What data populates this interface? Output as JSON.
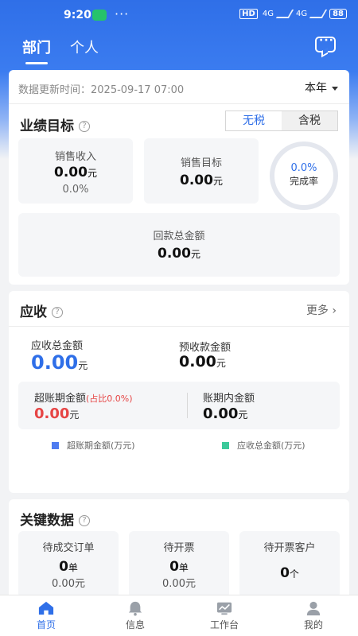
{
  "status_bar": {
    "time": "9:20",
    "dots": "···",
    "hd": "HD",
    "net1": "4G",
    "net2": "4G",
    "battery": "88"
  },
  "tabs": {
    "dept": "部门",
    "personal": "个人"
  },
  "summary": {
    "update_label": "数据更新时间：",
    "update_time": "2025-09-17 07:00",
    "period": "本年"
  },
  "performance": {
    "title": "业绩目标",
    "toggle_excl_tax": "无税",
    "toggle_incl_tax": "含税",
    "sales_income_label": "销售收入",
    "sales_income_value": "0.00",
    "sales_income_unit": "元",
    "sales_income_pct": "0.0%",
    "sales_target_label": "销售目标",
    "sales_target_value": "0.00",
    "sales_target_unit": "元",
    "completion_pct": "0.0%",
    "completion_label": "完成率",
    "collection_label": "回款总金额",
    "collection_value": "0.00",
    "collection_unit": "元"
  },
  "receivables": {
    "title": "应收",
    "more": "更多 ›",
    "total_label": "应收总金额",
    "total_value": "0.00",
    "total_unit": "元",
    "advance_label": "预收款金额",
    "advance_value": "0.00",
    "advance_unit": "元",
    "overdue_label": "超账期金额",
    "overdue_ratio": "(占比0.0%)",
    "overdue_value": "0.00",
    "overdue_unit": "元",
    "in_term_label": "账期内金额",
    "in_term_value": "0.00",
    "in_term_unit": "元",
    "legend_overdue": "超账期金额(万元)",
    "legend_total": "应收总金额(万元)"
  },
  "key_data": {
    "title": "关键数据",
    "pending_orders_label": "待成交订单",
    "pending_orders_count": "0",
    "pending_orders_unit": "单",
    "pending_orders_amount": "0.00元",
    "pending_invoice_label": "待开票",
    "pending_invoice_count": "0",
    "pending_invoice_unit": "单",
    "pending_invoice_amount": "0.00元",
    "pending_invoice_customers_label": "待开票客户",
    "pending_invoice_customers_count": "0",
    "pending_invoice_customers_unit": "个"
  },
  "bottom_nav": {
    "home": "首页",
    "messages": "信息",
    "workbench": "工作台",
    "mine": "我的"
  },
  "colors": {
    "primary": "#2f6fe8",
    "danger": "#e64545",
    "legend_overdue": "#4f7cf0",
    "legend_total": "#3cc99a"
  }
}
